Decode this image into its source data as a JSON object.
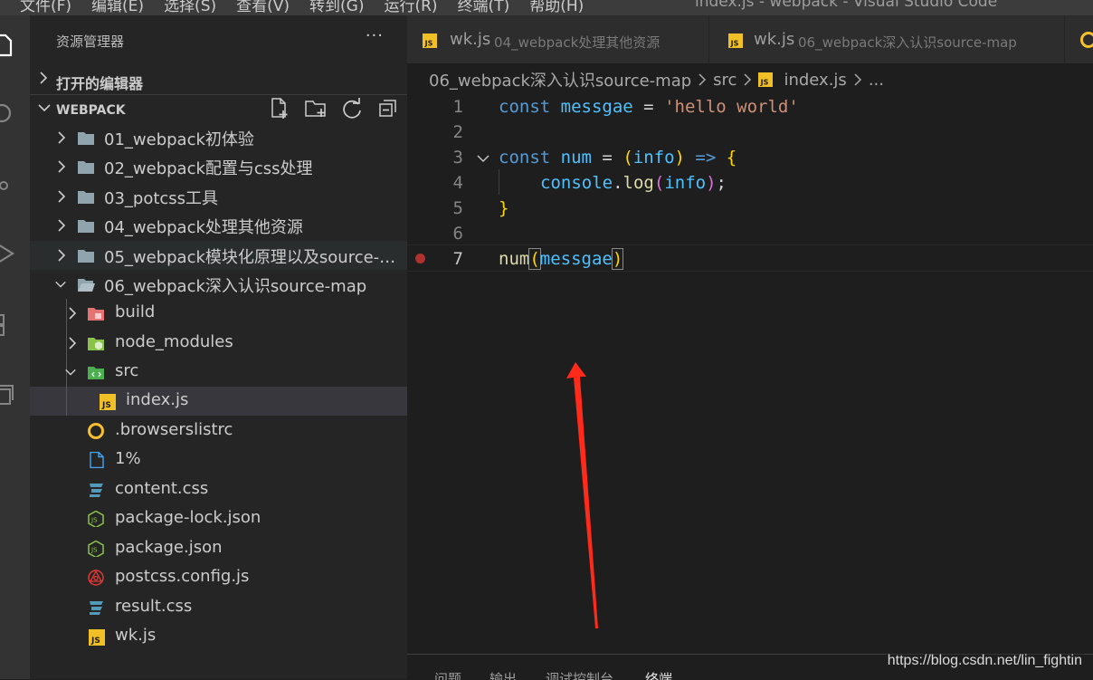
{
  "window": {
    "menu": [
      "文件(F)",
      "编辑(E)",
      "选择(S)",
      "查看(V)",
      "转到(G)",
      "运行(R)",
      "终端(T)",
      "帮助(H)"
    ],
    "title": "index.js - webpack - Visual Studio Code"
  },
  "sidebar": {
    "title": "资源管理器",
    "more": "···",
    "open_editors_label": "打开的编辑器",
    "workspace_label": "WEBPACK",
    "tree": [
      {
        "label": "01_webpack初体验",
        "kind": "folder"
      },
      {
        "label": "02_webpack配置与css处理",
        "kind": "folder"
      },
      {
        "label": "03_potcss工具",
        "kind": "folder"
      },
      {
        "label": "04_webpack处理其他资源",
        "kind": "folder"
      },
      {
        "label": "05_webpack模块化原理以及source-m...",
        "kind": "folder"
      },
      {
        "label": "06_webpack深入认识source-map",
        "kind": "folder-open"
      },
      {
        "label": "build",
        "kind": "folder-build"
      },
      {
        "label": "node_modules",
        "kind": "folder-node"
      },
      {
        "label": "src",
        "kind": "folder-src"
      },
      {
        "label": "index.js",
        "kind": "js"
      },
      {
        "label": ".browserslistrc",
        "kind": "browserslist"
      },
      {
        "label": "1%",
        "kind": "file"
      },
      {
        "label": "content.css",
        "kind": "css"
      },
      {
        "label": "package-lock.json",
        "kind": "node-json"
      },
      {
        "label": "package.json",
        "kind": "node-json"
      },
      {
        "label": "postcss.config.js",
        "kind": "postcss"
      },
      {
        "label": "result.css",
        "kind": "css"
      },
      {
        "label": "wk.js",
        "kind": "js"
      }
    ]
  },
  "tabs": [
    {
      "name": "wk.js",
      "description": "04_webpack处理其他资源"
    },
    {
      "name": "wk.js",
      "description": "06_webpack深入认识source-map"
    }
  ],
  "breadcrumbs": {
    "parts": [
      "06_webpack深入认识source-map",
      "src",
      "index.js",
      "..."
    ]
  },
  "editor": {
    "line_numbers": [
      "1",
      "2",
      "3",
      "4",
      "5",
      "6",
      "7"
    ],
    "tokens": {
      "l1_const": "const",
      "l1_name": "messgae",
      "l1_eq": " = ",
      "l1_str": "'hello world'",
      "l3_const": "const",
      "l3_name": "num",
      "l3_eq": " = ",
      "l3_open": "(",
      "l3_param": "info",
      "l3_close": ")",
      "l3_arrow": " => ",
      "l3_brace": "{",
      "l4_console": "console",
      "l4_dot": ".",
      "l4_log": "log",
      "l4_open": "(",
      "l4_arg": "info",
      "l4_close": ")",
      "l4_semi": ";",
      "l5_brace": "}",
      "l7_fn": "num",
      "l7_open": "(",
      "l7_arg": "messgae",
      "l7_close": ")"
    }
  },
  "panel": {
    "tabs": [
      "问题",
      "输出",
      "调试控制台",
      "终端"
    ]
  },
  "watermark": "https://blog.csdn.net/lin_fightin",
  "colors": {
    "accent_arrow": "#ff2a1a",
    "breakpoint": "#b0302d",
    "js_icon": "#f1bf26",
    "css_icon": "#519aba",
    "node_icon": "#8bc34a"
  }
}
